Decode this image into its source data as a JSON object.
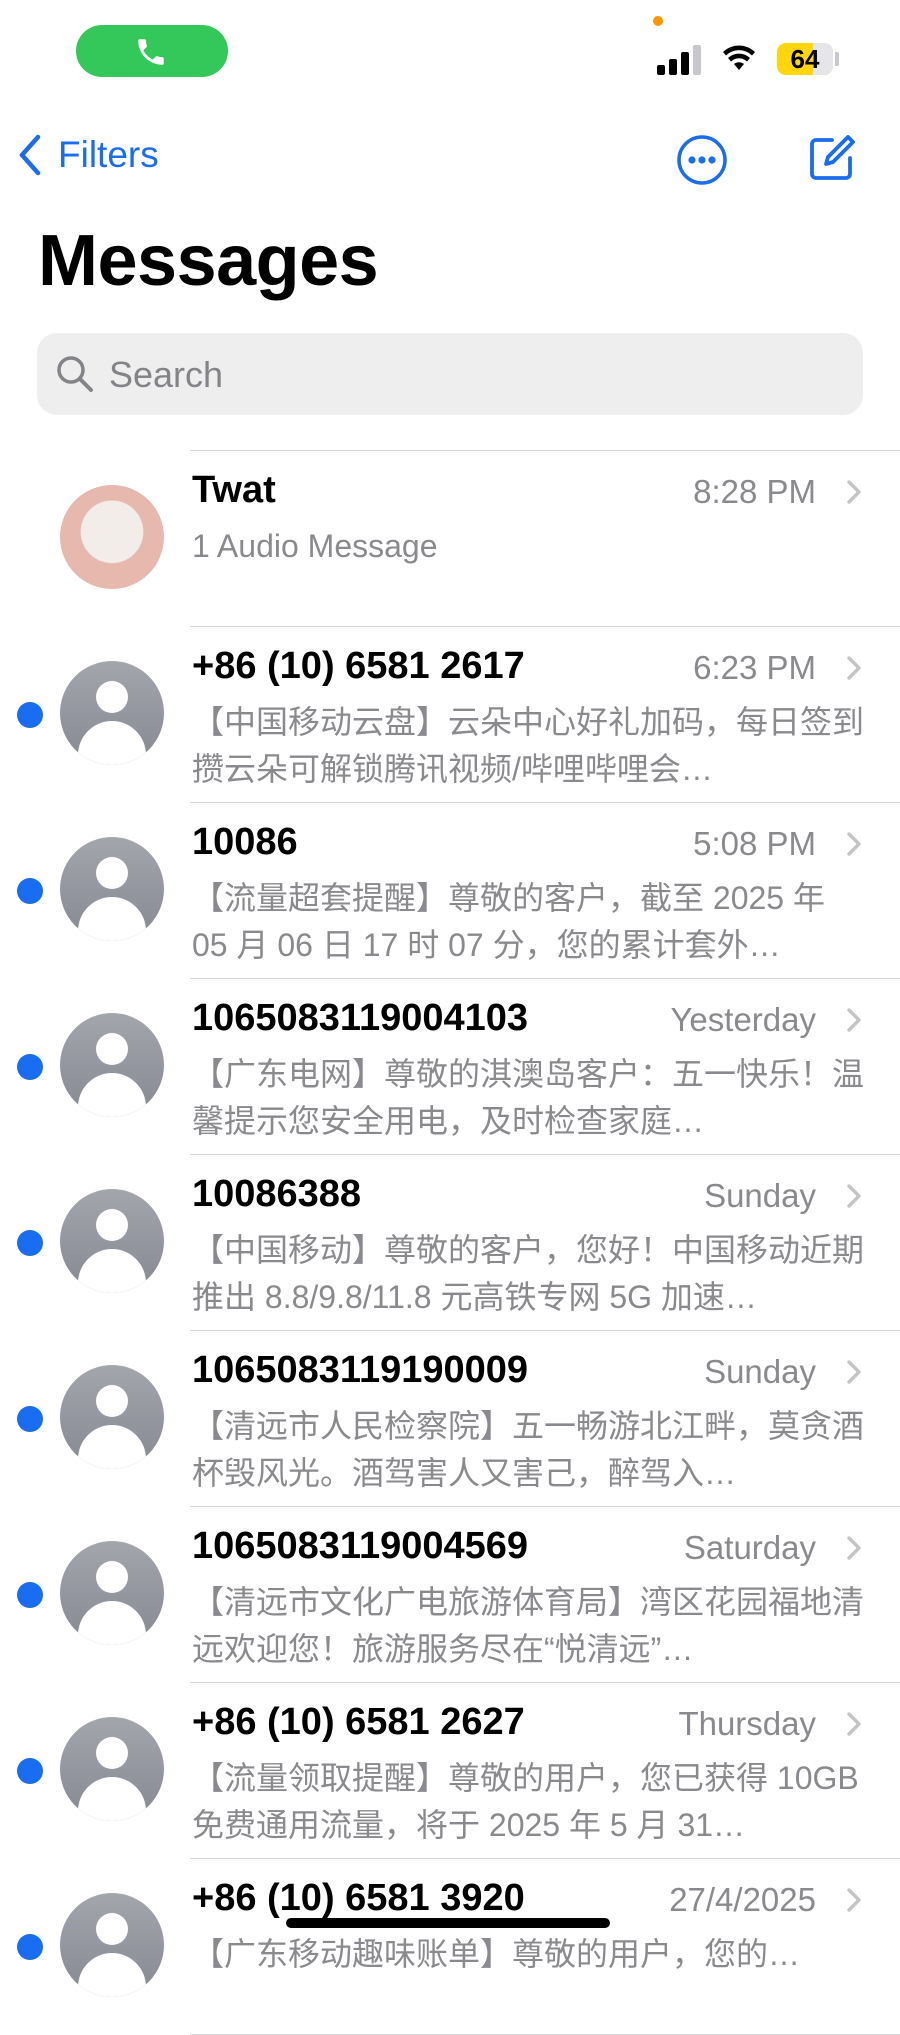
{
  "status_bar": {
    "battery": "64",
    "call_active": true
  },
  "nav": {
    "back_label": "Filters"
  },
  "title": "Messages",
  "search": {
    "placeholder": "Search"
  },
  "colors": {
    "accent": "#1a6cf0",
    "call_pill": "#34c759",
    "battery": "#ffd60a",
    "secondary_text": "#8a8a8e"
  },
  "conversations": [
    {
      "sender": "Twat",
      "time": "8:28 PM",
      "preview": "1 Audio Message",
      "unread": false,
      "avatar": "photo"
    },
    {
      "sender": "+86 (10) 6581 2617",
      "time": "6:23 PM",
      "preview": "【中国移动云盘】云朵中心好礼加码，每日签到攒云朵可解锁腾讯视频/哔哩哔哩会…",
      "unread": true,
      "avatar": "person-icon"
    },
    {
      "sender": "10086",
      "time": "5:08 PM",
      "preview": "【流量超套提醒】尊敬的客户，截至 2025 年 05 月 06 日 17 时 07 分，您的累计套外…",
      "unread": true,
      "avatar": "person-icon"
    },
    {
      "sender": "1065083119004103",
      "time": "Yesterday",
      "preview": "【广东电网】尊敬的淇澳岛客户：五一快乐！温馨提示您安全用电，及时检查家庭…",
      "unread": true,
      "avatar": "person-icon"
    },
    {
      "sender": "10086388",
      "time": "Sunday",
      "preview": "【中国移动】尊敬的客户，您好！中国移动近期推出 8.8/9.8/11.8 元高铁专网 5G 加速…",
      "unread": true,
      "avatar": "person-icon"
    },
    {
      "sender": "1065083119190009",
      "time": "Sunday",
      "preview": "【清远市人民检察院】五一畅游北江畔，莫贪酒杯毁风光。酒驾害人又害己，醉驾入…",
      "unread": true,
      "avatar": "person-icon"
    },
    {
      "sender": "1065083119004569",
      "time": "Saturday",
      "preview": "【清远市文化广电旅游体育局】湾区花园福地清远欢迎您！旅游服务尽在“悦清远”…",
      "unread": true,
      "avatar": "person-icon"
    },
    {
      "sender": "+86 (10) 6581 2627",
      "time": "Thursday",
      "preview": "【流量领取提醒】尊敬的用户，您已获得 10GB 免费通用流量，将于 2025 年 5 月 31…",
      "unread": true,
      "avatar": "person-icon"
    },
    {
      "sender": "+86 (10) 6581 3920",
      "time": "27/4/2025",
      "preview": "【广东移动趣味账单】尊敬的用户，您的…",
      "unread": true,
      "avatar": "person-icon"
    }
  ]
}
